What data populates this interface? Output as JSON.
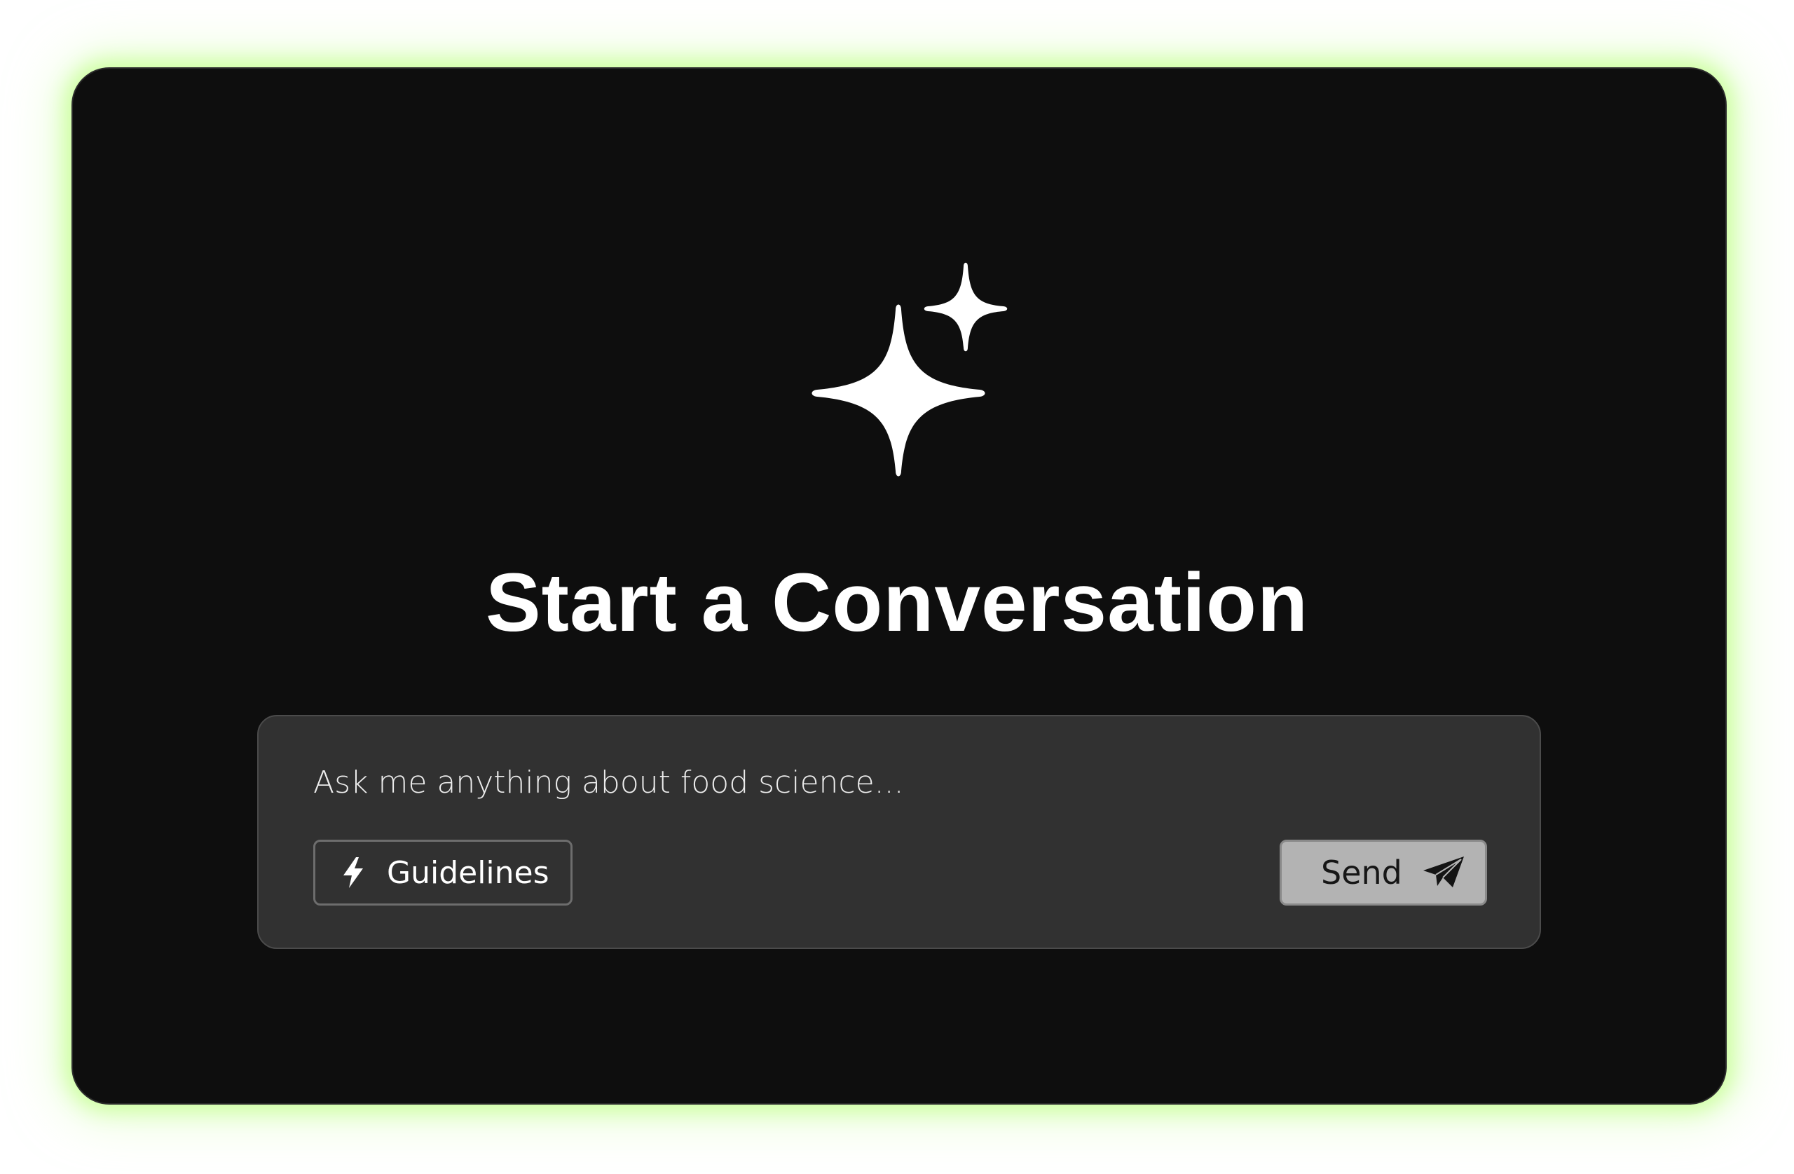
{
  "hero": {
    "icon": "sparkles-icon",
    "title": "Start a Conversation"
  },
  "composer": {
    "placeholder": "Ask me anything about food science...",
    "value": "",
    "guidelines_label": "Guidelines",
    "guidelines_icon": "lightning-bolt-icon",
    "send_label": "Send",
    "send_icon": "paper-plane-icon"
  },
  "colors": {
    "card_background": "#0e0e0e",
    "glow": "#c8ff96",
    "composer_background": "#313131",
    "send_button_background": "#b3b3b3",
    "text_primary": "#ffffff"
  }
}
